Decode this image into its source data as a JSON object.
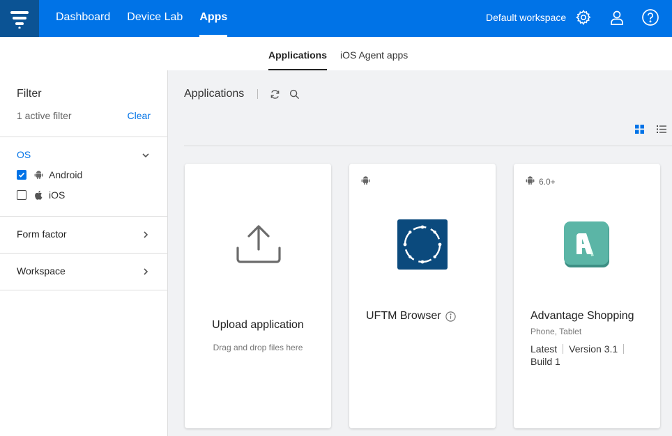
{
  "topbar": {
    "nav": [
      "Dashboard",
      "Device Lab",
      "Apps"
    ],
    "active_nav": "Apps",
    "workspace_label": "Default workspace",
    "brand_color": "#0073e7",
    "logo_bg": "#0b5394"
  },
  "subtabs": [
    "Applications",
    "iOS Agent apps"
  ],
  "sidebar": {
    "filter_title": "Filter",
    "active_filter_text": "1 active filter",
    "clear_label": "Clear",
    "os_section": {
      "label": "OS",
      "options": [
        {
          "label": "Android",
          "checked": true,
          "icon": "android-icon"
        },
        {
          "label": "iOS",
          "checked": false,
          "icon": "apple-icon"
        }
      ]
    },
    "sections": [
      "Form factor",
      "Workspace"
    ]
  },
  "main": {
    "title": "Applications",
    "cards": [
      {
        "type": "upload",
        "title": "Upload application",
        "subtitle": "Drag and drop files here"
      },
      {
        "type": "app",
        "name": "UFTM Browser",
        "os_icon": "android-icon",
        "icon_bg": "#0b4a7d"
      },
      {
        "type": "app",
        "name": "Advantage Shopping",
        "os_icon": "android-icon",
        "os_version": "6.0+",
        "form_factor": "Phone, Tablet",
        "meta": [
          "Latest",
          "Version 3.1",
          "Build 1"
        ],
        "icon_bg": "#5bb5a6"
      }
    ]
  }
}
